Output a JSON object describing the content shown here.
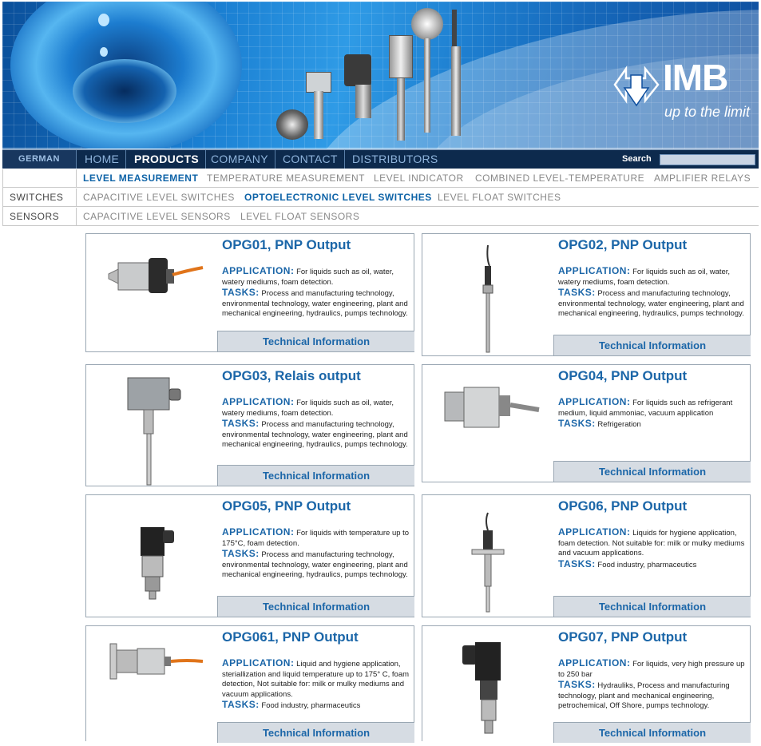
{
  "banner": {
    "logo_name": "IMB",
    "logo_tagline": "up to the limit"
  },
  "nav": {
    "language": "GERMAN",
    "items": [
      {
        "label": "HOME",
        "active": false
      },
      {
        "label": "PRODUCTS",
        "active": true
      },
      {
        "label": "COMPANY",
        "active": false
      },
      {
        "label": "CONTACT",
        "active": false
      },
      {
        "label": "DISTRIBUTORS",
        "active": false
      }
    ],
    "search_label": "Search",
    "search_value": ""
  },
  "categories": {
    "side_label": "",
    "items": [
      {
        "label": "LEVEL MEASUREMENT",
        "selected": true
      },
      {
        "label": "TEMPERATURE MEASUREMENT",
        "selected": false
      },
      {
        "label": "LEVEL INDICATOR",
        "selected": false
      },
      {
        "label": "COMBINED LEVEL-TEMPERATURE",
        "selected": false
      },
      {
        "label": "AMPLIFIER RELAYS",
        "selected": false
      }
    ]
  },
  "switches": {
    "side_label": "SWITCHES",
    "items": [
      {
        "label": "CAPACITIVE LEVEL SWITCHES",
        "selected": false
      },
      {
        "label": "OPTOELECTRONIC LEVEL SWITCHES",
        "selected": true
      },
      {
        "label": "LEVEL FLOAT SWITCHES",
        "selected": false
      }
    ]
  },
  "sensors": {
    "side_label": "SENSORS",
    "items": [
      {
        "label": "CAPACITIVE LEVEL SENSORS",
        "selected": false
      },
      {
        "label": "LEVEL FLOAT SENSORS",
        "selected": false
      }
    ]
  },
  "products": [
    {
      "title": "OPG01, PNP Output",
      "application_label": "APPLICATION:",
      "application": "For liquids such as oil, water, watery mediums, foam detection.",
      "tasks_label": "TASKS:",
      "tasks": "Process and manufacturing technology, environmental technology, water engineering, plant and mechanical engineering, hydraulics, pumps technology.",
      "button": "Technical Information"
    },
    {
      "title": "OPG02, PNP Output",
      "application_label": "APPLICATION:",
      "application": "For liquids such as oil, water, watery mediums, foam detection.",
      "tasks_label": "TASKS:",
      "tasks": "Process and manufacturing technology, environmental technology, water engineering, plant and mechanical engineering, hydraulics, pumps technology.",
      "button": "Technical Information"
    },
    {
      "title": "OPG03, Relais output",
      "application_label": "APPLICATION:",
      "application": "For liquids such as oil, water, watery mediums, foam detection.",
      "tasks_label": "TASKS:",
      "tasks": "Process and manufacturing technology, environmental technology, water engineering, plant and mechanical engineering, hydraulics, pumps technology.",
      "button": "Technical Information"
    },
    {
      "title": "OPG04, PNP Output",
      "application_label": "APPLICATION:",
      "application": "For liquids such as refrigerant medium, liquid ammoniac, vacuum application",
      "tasks_label": "TASKS:",
      "tasks": "Refrigeration",
      "button": "Technical Information"
    },
    {
      "title": "OPG05, PNP Output",
      "application_label": "APPLICATION:",
      "application": "For liquids with temperature up to 175°C, foam detection.",
      "tasks_label": "TASKS:",
      "tasks": "Process and manufacturing technology, environmental technology, water engineering, plant and mechanical engineering, hydraulics, pumps technology.",
      "button": "Technical Information"
    },
    {
      "title": "OPG06, PNP Output",
      "application_label": "APPLICATION:",
      "application": "Liquids for hygiene application, foam detection. Not suitable for: milk or mulky mediums and vacuum applications.",
      "tasks_label": "TASKS:",
      "tasks": "Food industry, pharmaceutics",
      "button": "Technical Information"
    },
    {
      "title": "OPG061, PNP Output",
      "application_label": "APPLICATION:",
      "application": "Liquid and hygiene application, steriallization and liquid temperature up to 175° C,  foam detection, Not suitable for: milk or mulky mediums and vacuum applications.",
      "tasks_label": "TASKS:",
      "tasks": "Food industry, pharmaceutics",
      "button": "Technical Information"
    },
    {
      "title": "OPG07, PNP Output",
      "application_label": "APPLICATION:",
      "application": "For liquids, very high pressure up to 250 bar",
      "tasks_label": "TASKS:",
      "tasks": "Hydrauliks, Process and manufacturing technology,  plant and mechanical engineering, petrochemical, Off Shore, pumps technology.",
      "button": "Technical Information"
    }
  ]
}
